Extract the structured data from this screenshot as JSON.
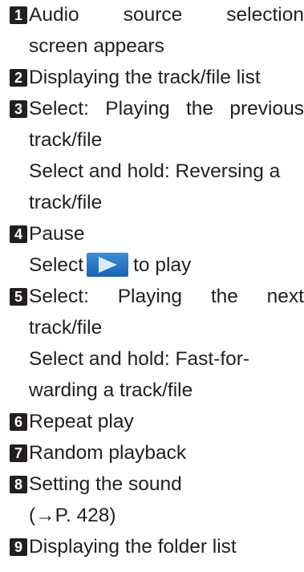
{
  "items": [
    {
      "num": "1",
      "lines": [
        [
          "Audio",
          "source",
          "selection"
        ],
        "screen appears"
      ]
    },
    {
      "num": "2",
      "lines": [
        "Displaying the track/file list"
      ]
    },
    {
      "num": "3",
      "lines": [
        [
          "Select:",
          "Playing",
          "the",
          "previous"
        ],
        "track/file",
        "Select and hold: Reversing a",
        "track/file"
      ]
    },
    {
      "num": "4",
      "lines": [
        "Pause",
        {
          "before": "Select",
          "after": "to play",
          "icon": "play-icon"
        }
      ]
    },
    {
      "num": "5",
      "lines": [
        [
          "Select:",
          "Playing",
          "the",
          "next"
        ],
        "track/file",
        "Select and hold: Fast-for-",
        "warding a track/file"
      ]
    },
    {
      "num": "6",
      "lines": [
        "Repeat play"
      ]
    },
    {
      "num": "7",
      "lines": [
        "Random playback"
      ]
    },
    {
      "num": "8",
      "lines": [
        "Setting the sound",
        "(→P. 428)"
      ]
    },
    {
      "num": "9",
      "lines": [
        "Displaying the folder list"
      ]
    }
  ],
  "colors": {
    "badge": "#231f20",
    "text": "#231f20",
    "play_button": "#2a78c6"
  }
}
